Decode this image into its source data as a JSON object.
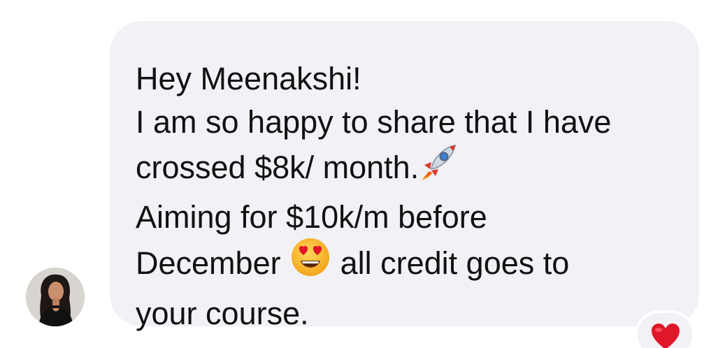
{
  "message": {
    "lines": [
      "Hey Meenakshi!",
      "I am so happy to share that I have",
      "crossed $8k/ month.",
      "Aiming for $10k/m before",
      "December",
      "all credit goes to",
      "your course."
    ],
    "emojis": {
      "line3": "rocket-icon",
      "line5": "heart-eyes-emoji-icon"
    }
  },
  "reaction": {
    "icon": "red-heart-icon",
    "color": "#e0162b"
  },
  "sender": {
    "avatar": "avatar"
  },
  "colors": {
    "bubble": "#f1f1f6",
    "text": "#111111"
  }
}
